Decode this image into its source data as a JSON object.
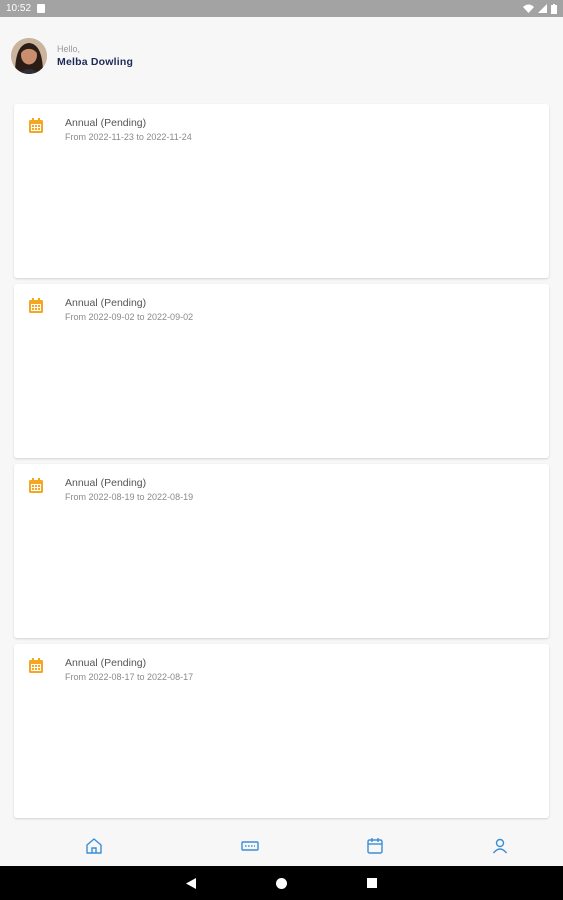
{
  "status_bar": {
    "time": "10:52"
  },
  "header": {
    "greeting": "Hello,",
    "user_name": "Melba  Dowling"
  },
  "leaves": [
    {
      "title": "Annual  (Pending)",
      "range": "From 2022-11-23 to 2022-11-24"
    },
    {
      "title": "Annual  (Pending)",
      "range": "From 2022-09-02 to 2022-09-02"
    },
    {
      "title": "Annual  (Pending)",
      "range": "From 2022-08-19 to 2022-08-19"
    },
    {
      "title": "Annual  (Pending)",
      "range": "From 2022-08-17 to 2022-08-17"
    }
  ],
  "colors": {
    "accent": "#f5a623",
    "nav_icon": "#3b8ed6",
    "name": "#1d2a57"
  },
  "bottom_nav": [
    "home-icon",
    "ticket-icon",
    "calendar-icon",
    "person-icon"
  ]
}
